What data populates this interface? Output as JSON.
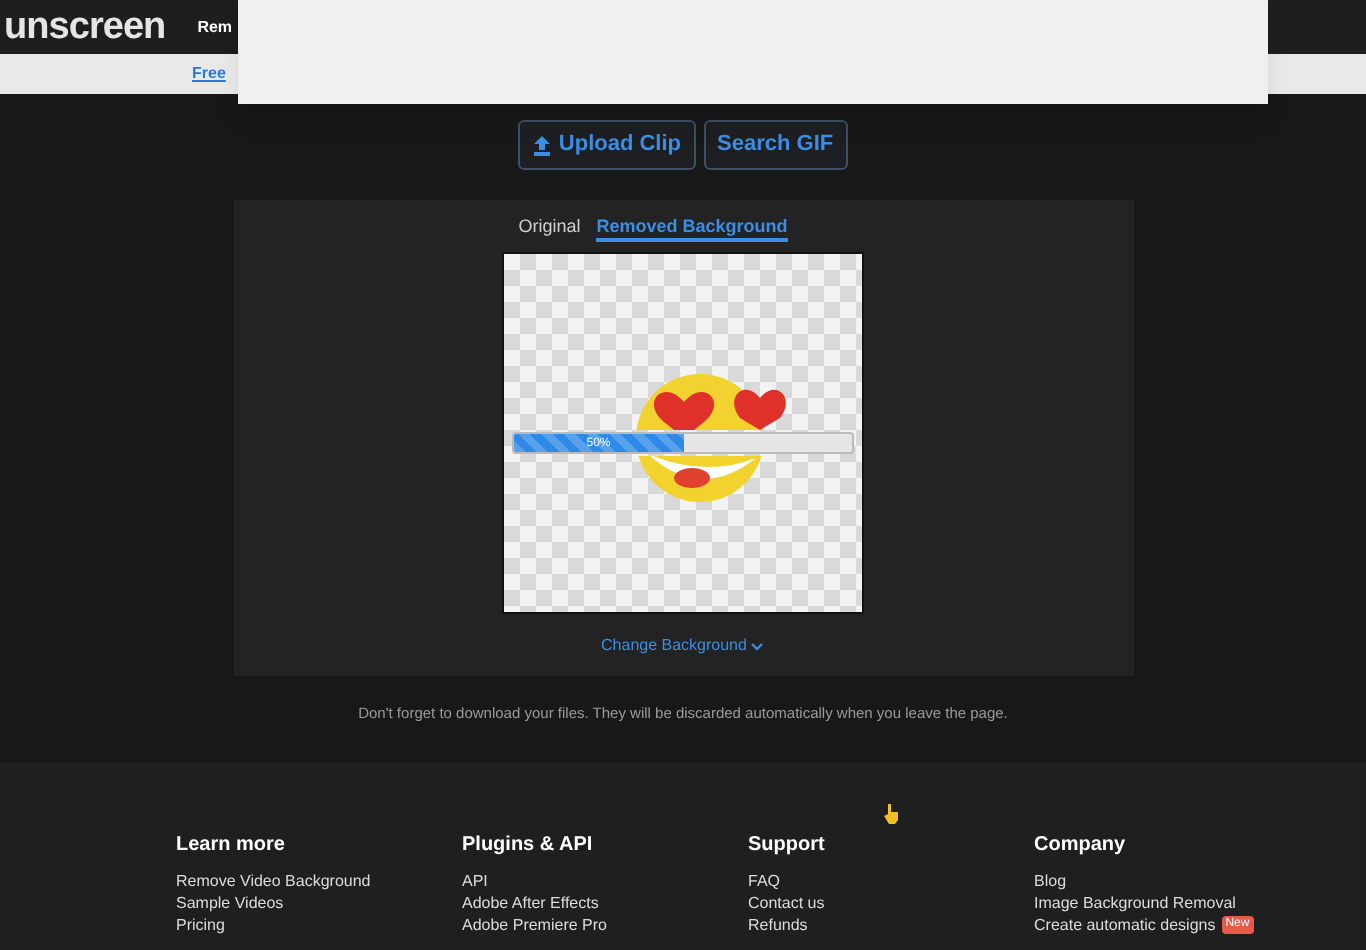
{
  "header": {
    "logo": "unscreen",
    "nav_item": "Rem"
  },
  "subnav": {
    "link": "Free"
  },
  "buttons": [
    {
      "kind": "upload",
      "label": "Upload Clip"
    },
    {
      "kind": "plain",
      "label": "Search GIF"
    }
  ],
  "tabs": [
    {
      "label": "Original",
      "selected": false
    },
    {
      "label": "Removed Background",
      "selected": true
    }
  ],
  "progress": {
    "level": 0.5,
    "reading": "50%"
  },
  "change_background": "Change Background",
  "notice": "Don't forget to download your files. They will be discarded automatically when you leave the page.",
  "footer": {
    "columns": [
      {
        "heading": "Learn more",
        "links": [
          {
            "label": "Remove Video Background"
          },
          {
            "label": "Sample Videos"
          },
          {
            "label": "Pricing"
          }
        ]
      },
      {
        "heading": "Plugins & API",
        "links": [
          {
            "label": "API"
          },
          {
            "label": "Adobe After Effects"
          },
          {
            "label": "Adobe Premiere Pro"
          }
        ]
      },
      {
        "heading": "Support",
        "links": [
          {
            "label": "FAQ"
          },
          {
            "label": "Contact us"
          },
          {
            "label": "Refunds"
          }
        ]
      },
      {
        "heading": "Company",
        "links": [
          {
            "label": "Blog"
          },
          {
            "label": "Image Background Removal"
          },
          {
            "label": "Create automatic designs",
            "badge": "New"
          }
        ]
      }
    ]
  }
}
